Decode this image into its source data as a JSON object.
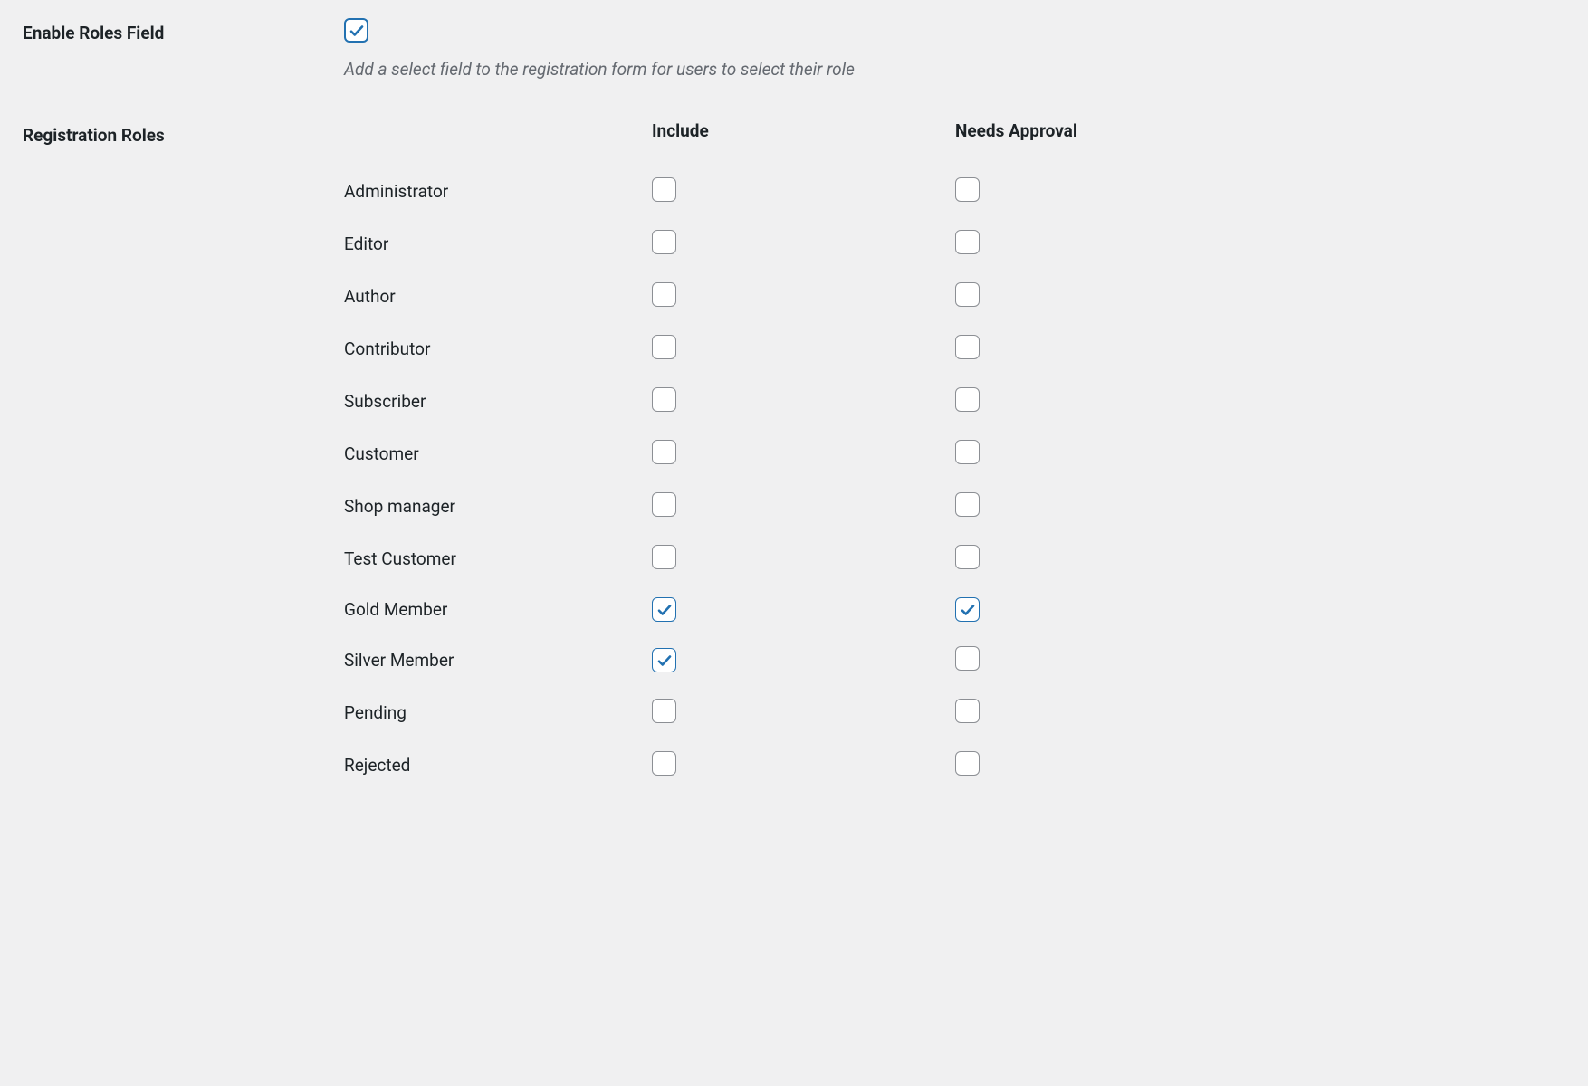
{
  "enable_roles": {
    "label": "Enable Roles Field",
    "checked": true,
    "description": "Add a select field to the registration form for users to select their role"
  },
  "registration_roles": {
    "label": "Registration Roles",
    "headers": {
      "include": "Include",
      "needs_approval": "Needs Approval"
    },
    "roles": [
      {
        "name": "Administrator",
        "include": false,
        "needs_approval": false
      },
      {
        "name": "Editor",
        "include": false,
        "needs_approval": false
      },
      {
        "name": "Author",
        "include": false,
        "needs_approval": false
      },
      {
        "name": "Contributor",
        "include": false,
        "needs_approval": false
      },
      {
        "name": "Subscriber",
        "include": false,
        "needs_approval": false
      },
      {
        "name": "Customer",
        "include": false,
        "needs_approval": false
      },
      {
        "name": "Shop manager",
        "include": false,
        "needs_approval": false
      },
      {
        "name": "Test Customer",
        "include": false,
        "needs_approval": false
      },
      {
        "name": "Gold Member",
        "include": true,
        "needs_approval": true
      },
      {
        "name": "Silver Member",
        "include": true,
        "needs_approval": false
      },
      {
        "name": "Pending",
        "include": false,
        "needs_approval": false
      },
      {
        "name": "Rejected",
        "include": false,
        "needs_approval": false
      }
    ]
  },
  "colors": {
    "accent": "#2271b1",
    "border": "#8c8f94"
  }
}
